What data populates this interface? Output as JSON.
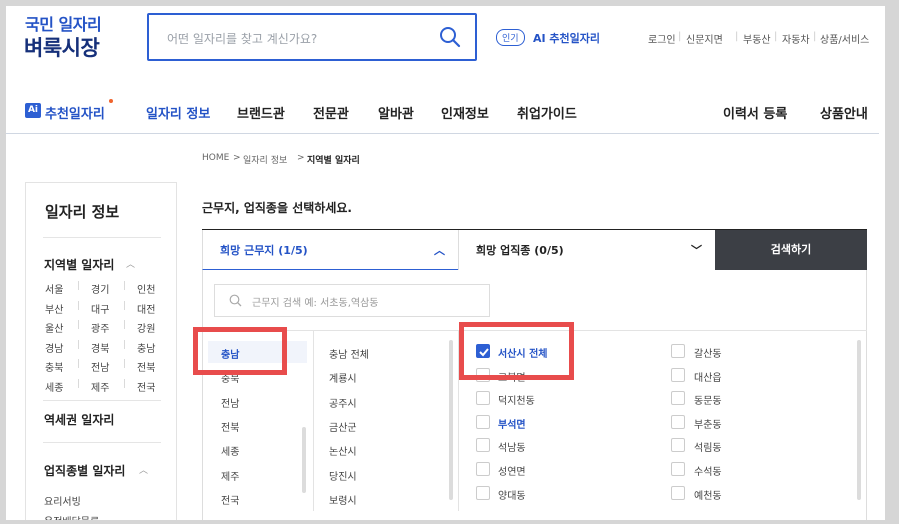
{
  "header": {
    "logo_line1": "국민 일자리",
    "logo_line2": "벼룩시장",
    "search_placeholder": "어떤 일자리를 찾고 계신가요?",
    "popular_badge": "인기",
    "ai_recommend": "AI 추천일자리",
    "util_links": [
      "로그인",
      "신문지면",
      "부동산",
      "자동차",
      "상품/서비스"
    ]
  },
  "nav": {
    "ai_badge": "Ai",
    "items": [
      "추천일자리",
      "일자리 정보",
      "브랜드관",
      "전문관",
      "알바관",
      "인재정보",
      "취업가이드"
    ],
    "right_items": [
      "이력서 등록",
      "상품안내"
    ]
  },
  "breadcrumb": {
    "home": "HOME",
    "sep": ">",
    "mid": "일자리 정보",
    "current": "지역별 일자리"
  },
  "sidebar": {
    "title": "일자리 정보",
    "section_region": "지역별 일자리",
    "regions": [
      [
        "서울",
        "경기",
        "인천"
      ],
      [
        "부산",
        "대구",
        "대전"
      ],
      [
        "울산",
        "광주",
        "강원"
      ],
      [
        "경남",
        "경북",
        "충남"
      ],
      [
        "충북",
        "전남",
        "전북"
      ],
      [
        "세종",
        "제주",
        "전국"
      ]
    ],
    "section_station": "역세권 일자리",
    "section_job": "업직종별 일자리",
    "job_items": [
      "요리서빙",
      "운전배달물류"
    ]
  },
  "main": {
    "title": "근무지, 업직종을 선택하세요.",
    "tab_location": "희망 근무지 (1/5)",
    "tab_job": "희망 업직종 (0/5)",
    "search_button": "검색하기",
    "location_search_placeholder": "근무지 검색 예: 서초동,역삼동",
    "provinces": [
      "충남",
      "충북",
      "전남",
      "전북",
      "세종",
      "제주",
      "전국"
    ],
    "cities": [
      "충남 전체",
      "계룡시",
      "공주시",
      "금산군",
      "논산시",
      "당진시",
      "보령시"
    ],
    "options_left": [
      {
        "label": "서산시 전체",
        "checked": true
      },
      {
        "label": "고북면",
        "checked": false
      },
      {
        "label": "덕지천동",
        "checked": false
      },
      {
        "label": "부석면",
        "checked": false,
        "highlight": true
      },
      {
        "label": "석남동",
        "checked": false
      },
      {
        "label": "성연면",
        "checked": false
      },
      {
        "label": "양대동",
        "checked": false
      }
    ],
    "options_right": [
      {
        "label": "갈산동",
        "checked": false
      },
      {
        "label": "대산읍",
        "checked": false
      },
      {
        "label": "동문동",
        "checked": false
      },
      {
        "label": "부춘동",
        "checked": false
      },
      {
        "label": "석림동",
        "checked": false
      },
      {
        "label": "수석동",
        "checked": false
      },
      {
        "label": "예천동",
        "checked": false
      }
    ]
  },
  "colors": {
    "accent": "#2d5fd3",
    "brand_dark": "#16307a",
    "search_button_bg": "#3c3f45",
    "annotation_red": "#e84c4c"
  }
}
